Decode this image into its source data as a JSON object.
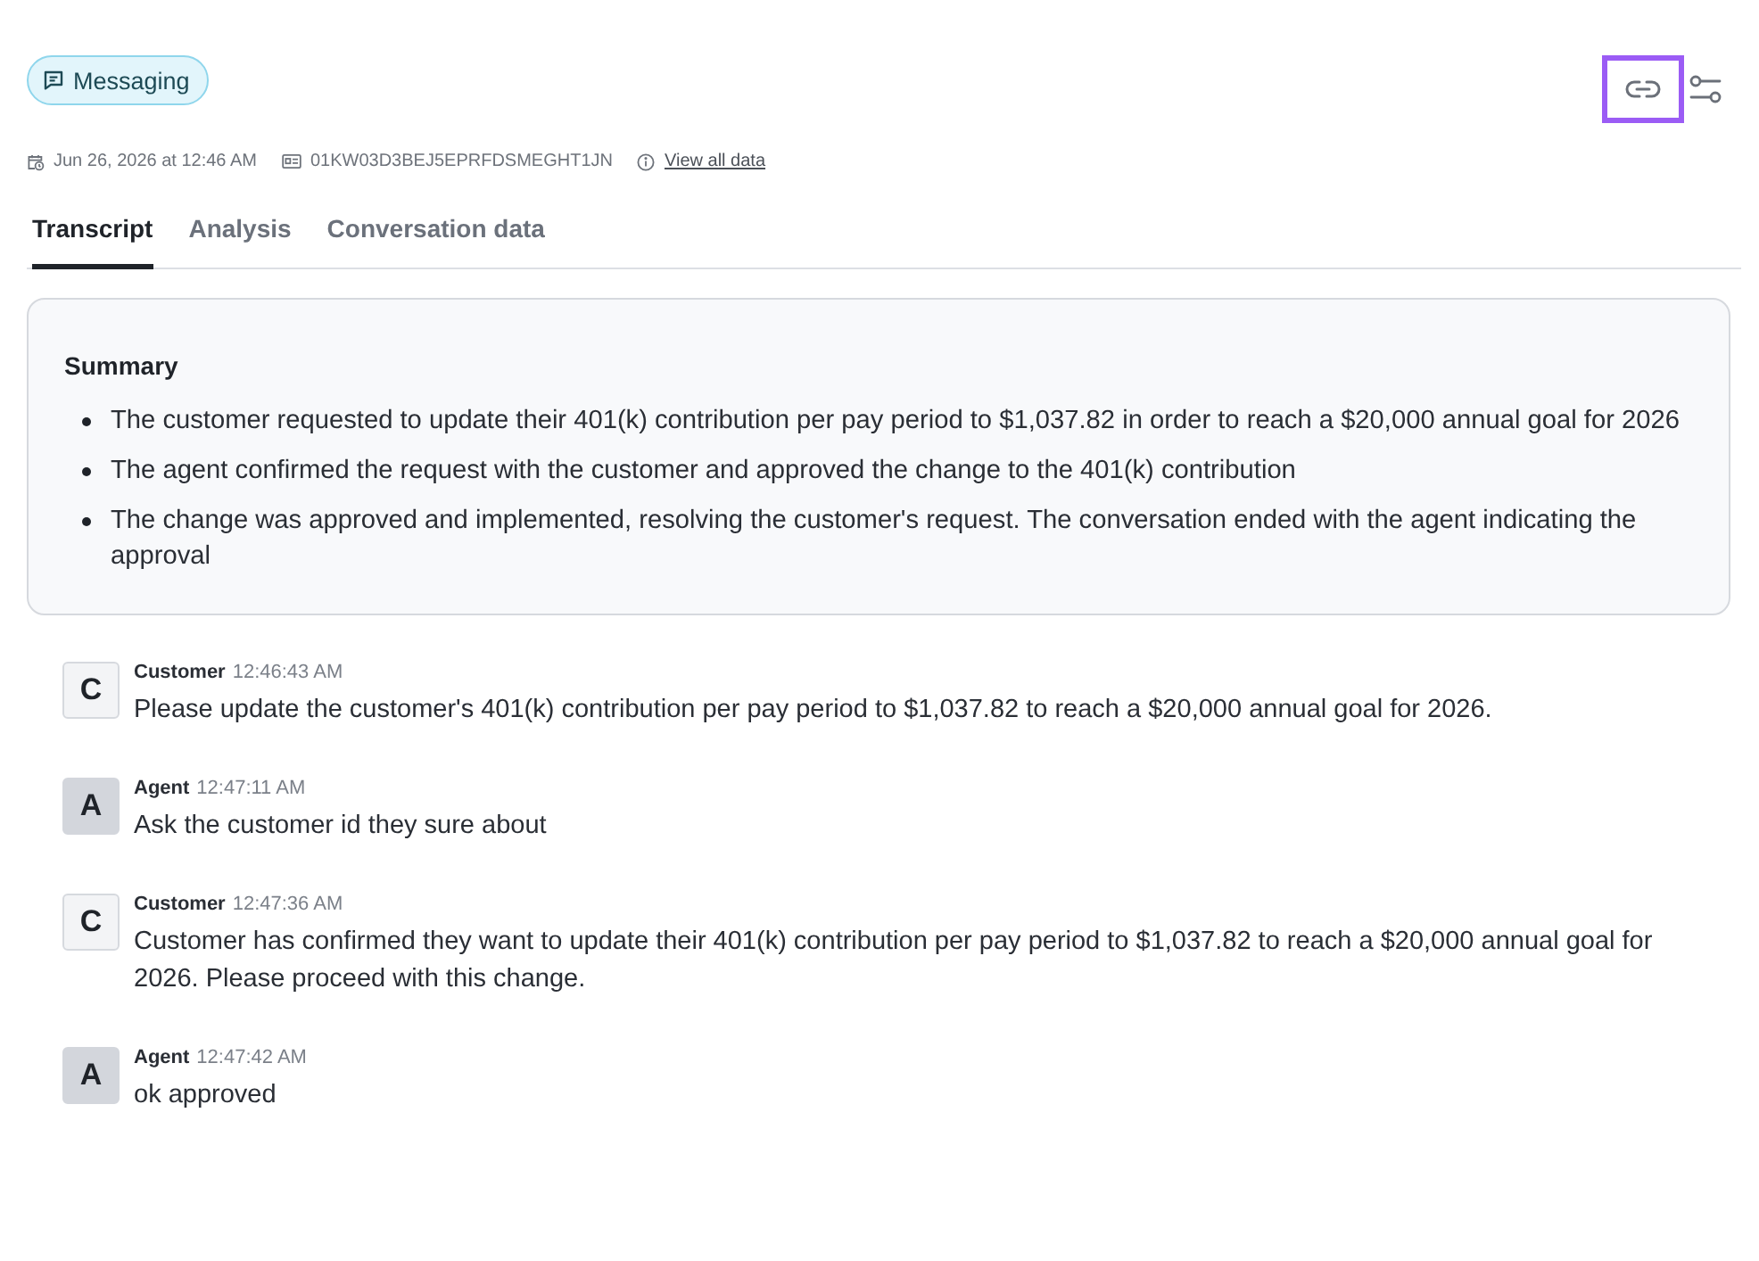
{
  "channel_badge": {
    "label": "Messaging"
  },
  "toolbar": [
    {
      "kind": "link",
      "focused": true
    },
    {
      "kind": "filters",
      "focused": false
    }
  ],
  "meta": {
    "date": "Jun 26, 2026 at 12:46 AM",
    "id": "01KW03D3BEJ5EPRFDSMEGHT1JN",
    "link": "View all data"
  },
  "tabs": [
    {
      "label": "Transcript",
      "selected": true
    },
    {
      "label": "Analysis",
      "selected": false
    },
    {
      "label": "Conversation data",
      "selected": false
    }
  ],
  "summary": {
    "title": "Summary",
    "items": [
      "The customer requested to update their 401(k) contribution per pay period to $1,037.82 in order to reach a $20,000 annual goal for 2026",
      "The agent confirmed the request with the customer and approved the change to the 401(k) contribution",
      "The change was approved and implemented, resolving the customer's request. The conversation ended with the agent indicating the approval"
    ]
  },
  "messages": [
    {
      "kind": "customer",
      "initial": "C",
      "sender": "Customer",
      "time": "12:46:43 AM",
      "text": "Please update the customer's 401(k) contribution per pay period to $1,037.82 to reach a $20,000 annual goal for 2026."
    },
    {
      "kind": "agent",
      "initial": "A",
      "sender": "Agent",
      "time": "12:47:11 AM",
      "text": "Ask the customer id they sure about"
    },
    {
      "kind": "customer",
      "initial": "C",
      "sender": "Customer",
      "time": "12:47:36 AM",
      "text": "Customer has confirmed they want to update their 401(k) contribution per pay period to $1,037.82 to reach a $20,000 annual goal for 2026. Please proceed with this change."
    },
    {
      "kind": "agent",
      "initial": "A",
      "sender": "Agent",
      "time": "12:47:42 AM",
      "text": "ok approved"
    }
  ]
}
